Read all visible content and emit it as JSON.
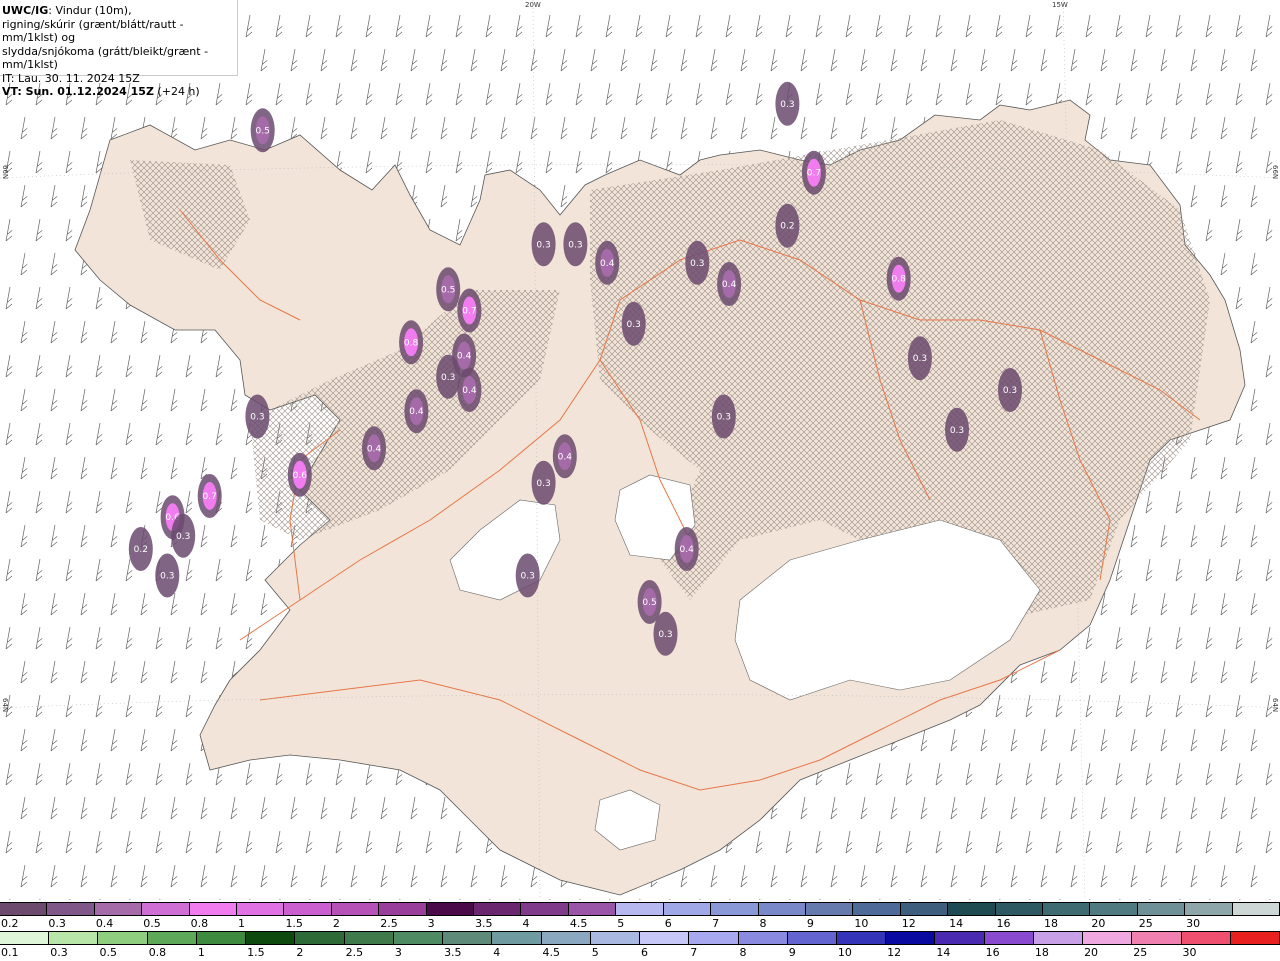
{
  "header": {
    "title_bold": "UWC/IG",
    "title_rest": ": Vindur (10m),",
    "line2": "rigning/skúrir (grænt/blátt/rautt - mm/1klst) og",
    "line3": "slydda/snjókoma (grátt/bleikt/grænt - mm/1klst)",
    "line4": "IT: Lau. 30. 11. 2024 15Z",
    "line5_bold": "VT: Sun. 01.12.2024 15Z",
    "line5_rest": " (+24 h)"
  },
  "grid_labels": {
    "top_left_lon": "20W",
    "top_right_lon": "15W",
    "left_upper_lat": "66N",
    "left_lower_lat": "64N",
    "right_upper_lat": "66N",
    "right_lower_lat": "64N"
  },
  "precip_labels": [
    {
      "text": "0.5",
      "lon": -22.55,
      "lat": 66.18
    },
    {
      "text": "0.3",
      "lon": -17.6,
      "lat": 66.28
    },
    {
      "text": "0.7",
      "lon": -17.35,
      "lat": 66.02
    },
    {
      "text": "0.2",
      "lon": -17.6,
      "lat": 65.82
    },
    {
      "text": "0.3",
      "lon": -19.9,
      "lat": 65.75
    },
    {
      "text": "0.3",
      "lon": -19.6,
      "lat": 65.75
    },
    {
      "text": "0.4",
      "lon": -19.3,
      "lat": 65.68
    },
    {
      "text": "0.3",
      "lon": -18.45,
      "lat": 65.68
    },
    {
      "text": "0.4",
      "lon": -18.15,
      "lat": 65.6
    },
    {
      "text": "0.8",
      "lon": -16.55,
      "lat": 65.62
    },
    {
      "text": "0.5",
      "lon": -20.8,
      "lat": 65.58
    },
    {
      "text": "0.7",
      "lon": -20.6,
      "lat": 65.5
    },
    {
      "text": "0.3",
      "lon": -19.05,
      "lat": 65.45
    },
    {
      "text": "0.8",
      "lon": -21.15,
      "lat": 65.38
    },
    {
      "text": "0.4",
      "lon": -20.65,
      "lat": 65.33
    },
    {
      "text": "0.3",
      "lon": -20.8,
      "lat": 65.25
    },
    {
      "text": "0.4",
      "lon": -20.6,
      "lat": 65.2
    },
    {
      "text": "0.3",
      "lon": -16.35,
      "lat": 65.32
    },
    {
      "text": "0.4",
      "lon": -21.1,
      "lat": 65.12
    },
    {
      "text": "0.3",
      "lon": -22.6,
      "lat": 65.1
    },
    {
      "text": "0.3",
      "lon": -18.2,
      "lat": 65.1
    },
    {
      "text": "0.3",
      "lon": -15.5,
      "lat": 65.2
    },
    {
      "text": "0.3",
      "lon": -16.0,
      "lat": 65.05
    },
    {
      "text": "0.4",
      "lon": -21.5,
      "lat": 64.98
    },
    {
      "text": "0.4",
      "lon": -19.7,
      "lat": 64.95
    },
    {
      "text": "0.6",
      "lon": -22.2,
      "lat": 64.88
    },
    {
      "text": "0.3",
      "lon": -19.9,
      "lat": 64.85
    },
    {
      "text": "0.7",
      "lon": -23.05,
      "lat": 64.8
    },
    {
      "text": "0.6",
      "lon": -23.4,
      "lat": 64.72
    },
    {
      "text": "0.3",
      "lon": -23.3,
      "lat": 64.65
    },
    {
      "text": "0.4",
      "lon": -18.55,
      "lat": 64.6
    },
    {
      "text": "0.3",
      "lon": -20.05,
      "lat": 64.5
    },
    {
      "text": "0.5",
      "lon": -18.9,
      "lat": 64.4
    },
    {
      "text": "0.3",
      "lon": -18.75,
      "lat": 64.28
    },
    {
      "text": "0.2",
      "lon": -23.7,
      "lat": 64.6
    },
    {
      "text": "0.3",
      "lon": -23.45,
      "lat": 64.5
    }
  ],
  "snow_scale": {
    "labels": [
      "0.2",
      "0.3",
      "0.4",
      "0.5",
      "0.8",
      "1",
      "1.5",
      "2",
      "2.5",
      "3",
      "3.5",
      "4",
      "4.5",
      "5",
      "6",
      "7",
      "8",
      "9",
      "10",
      "12",
      "14",
      "16",
      "18",
      "20",
      "25",
      "30"
    ],
    "colors": [
      "#6b4a6e",
      "#7f5788",
      "#a56aa8",
      "#cf6ed4",
      "#f07cf0",
      "#e072e4",
      "#cc5fd0",
      "#b551b7",
      "#9a3e9b",
      "#4a0a4a",
      "#6b2670",
      "#7f3a8a",
      "#9a55a8",
      "#b8b8f0",
      "#a0a8e8",
      "#8a98d8",
      "#7888c8",
      "#667aae",
      "#4e6a98",
      "#3e5e7e",
      "#1e4a52",
      "#2e5862",
      "#3e6a72",
      "#4e7a80",
      "#6e9096",
      "#8ea6aa",
      "#cdd8d6"
    ]
  },
  "rain_scale": {
    "labels": [
      "0.1",
      "0.3",
      "0.5",
      "0.8",
      "1",
      "1.5",
      "2",
      "2.5",
      "3",
      "3.5",
      "4",
      "4.5",
      "5",
      "6",
      "7",
      "8",
      "9",
      "10",
      "12",
      "14",
      "16",
      "18",
      "20",
      "25",
      "30"
    ],
    "colors": [
      "#dff6d8",
      "#b8e6a8",
      "#8fce7e",
      "#5ea85a",
      "#3e8a3e",
      "#0e4a0e",
      "#2e6a38",
      "#3e7a4a",
      "#4e8a62",
      "#5e8a7a",
      "#6e9aa0",
      "#8aa8c0",
      "#a8b8e0",
      "#c8c8f8",
      "#a8a8f0",
      "#8a8ae0",
      "#6464d0",
      "#3434b8",
      "#0a0aa0",
      "#4a2ab0",
      "#8a4ad0",
      "#c8a0e8",
      "#f0a8e0",
      "#f080b0",
      "#f05070",
      "#e82020"
    ]
  }
}
